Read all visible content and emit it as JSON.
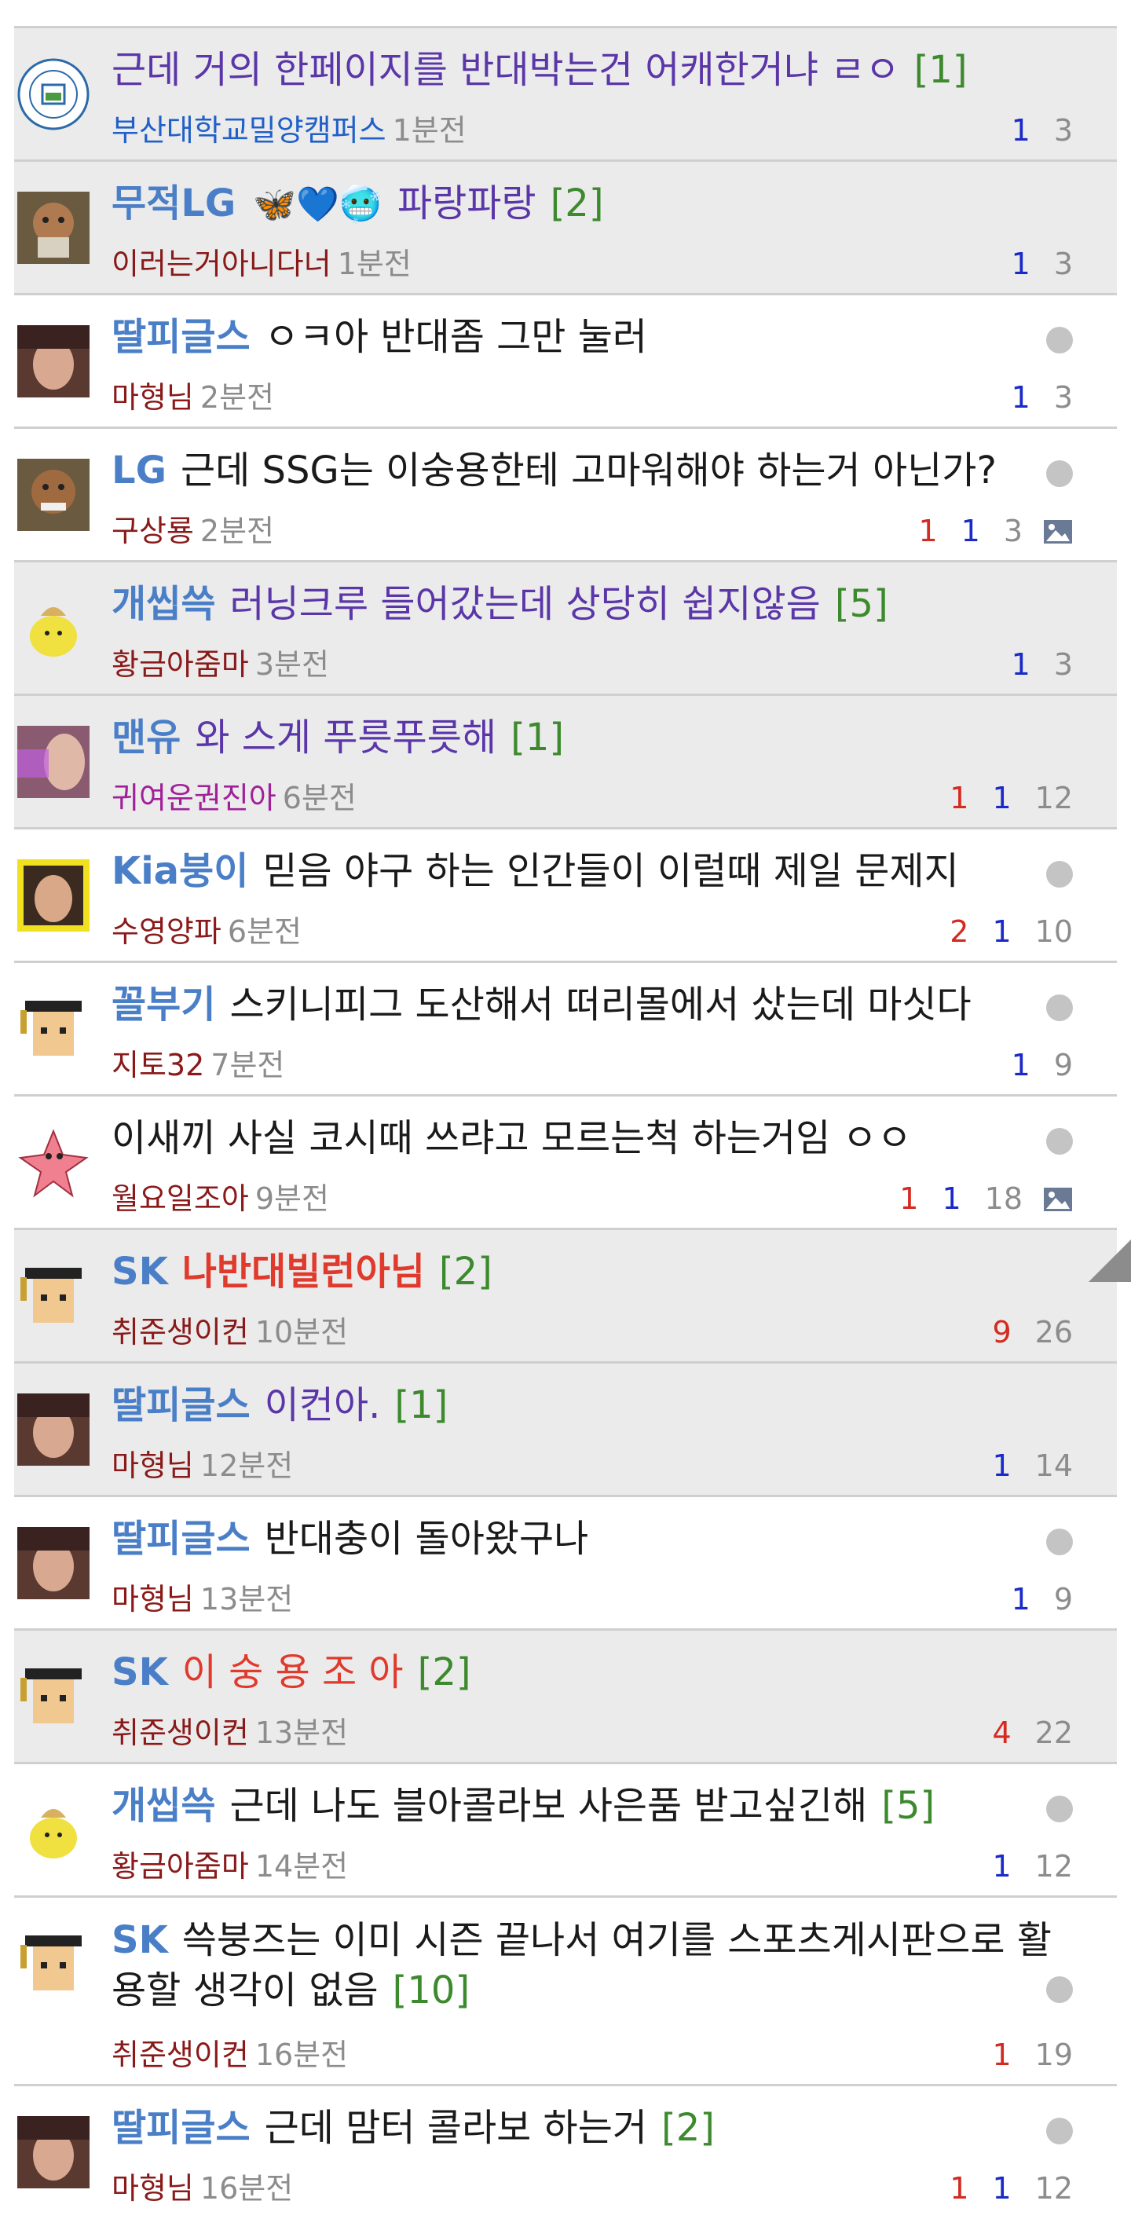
{
  "posts": [
    {
      "team": "",
      "title": "근데 거의 한페이지를 반대박는건 어캐한거냐 ㄹㅇ",
      "count": "[1]",
      "author": "부산대학교밀양캠퍼스",
      "time": "1분전",
      "stats": [
        "1",
        "3"
      ],
      "style": "purple"
    },
    {
      "team": "무적LG",
      "title": "파랑파랑",
      "count": "[2]",
      "author": "이러는거아니다너",
      "time": "1분전",
      "stats": [
        "1",
        "3"
      ],
      "style": "purple",
      "emoji": "🦋💙🥶"
    },
    {
      "team": "딸피글스",
      "title": "ㅇㅋ아 반대좀 그만 눌러",
      "count": "",
      "author": "마형님",
      "time": "2분전",
      "stats": [
        "1",
        "3"
      ],
      "style": "normal"
    },
    {
      "team": "LG",
      "title": "근데 SSG는 이숭용한테 고마워해야 하는거 아닌가?",
      "count": "",
      "author": "구상룡",
      "time": "2분전",
      "stats": [
        "1",
        "1",
        "3"
      ],
      "style": "normal"
    },
    {
      "team": "개씹쓱",
      "title": "러닝크루 들어갔는데 상당히 쉽지않음",
      "count": "[5]",
      "author": "황금아줌마",
      "time": "3분전",
      "stats": [
        "1",
        "3"
      ],
      "style": "purple"
    },
    {
      "team": "맨유",
      "title": "와 스게 푸릇푸릇해",
      "count": "[1]",
      "author": "귀여운권진아",
      "time": "6분전",
      "stats": [
        "1",
        "1",
        "12"
      ],
      "style": "purple"
    },
    {
      "team": "Kia붕이",
      "title": "믿음 야구 하는 인간들이 이럴때 제일 문제지",
      "count": "",
      "author": "수영양파",
      "time": "6분전",
      "stats": [
        "2",
        "1",
        "10"
      ],
      "style": "normal"
    },
    {
      "team": "꼴부기",
      "title": "스키니피그 도산해서 떠리몰에서 샀는데 마싯다",
      "count": "",
      "author": "지토32",
      "time": "7분전",
      "stats": [
        "1",
        "9"
      ],
      "style": "normal"
    },
    {
      "team": "",
      "title": "이새끼 사실 코시때 쓰랴고 모르는척 하는거임 ㅇㅇ",
      "count": "",
      "author": "월요일조아",
      "time": "9분전",
      "stats": [
        "1",
        "1",
        "18"
      ],
      "style": "normal"
    },
    {
      "team": "SK",
      "title": "나반대빌런아님",
      "count": "[2]",
      "author": "취준생이컨",
      "time": "10분전",
      "stats": [
        "9",
        "26"
      ],
      "style": "red"
    },
    {
      "team": "딸피글스",
      "title": "이컨아.",
      "count": "[1]",
      "author": "마형님",
      "time": "12분전",
      "stats": [
        "1",
        "14"
      ],
      "style": "purple"
    },
    {
      "team": "딸피글스",
      "title": "반대충이 돌아왔구나",
      "count": "",
      "author": "마형님",
      "time": "13분전",
      "stats": [
        "1",
        "9"
      ],
      "style": "normal"
    },
    {
      "team": "SK",
      "title": "이 숭 용 조 아",
      "count": "[2]",
      "author": "취준생이컨",
      "time": "13분전",
      "stats": [
        "4",
        "22"
      ],
      "style": "red"
    },
    {
      "team": "개씹쓱",
      "title": "근데 나도 블아콜라보 사은품 받고싶긴해",
      "count": "[5]",
      "author": "황금아줌마",
      "time": "14분전",
      "stats": [
        "1",
        "12"
      ],
      "style": "normal"
    },
    {
      "team": "SK",
      "title": "쓱붕즈는 이미 시즌 끝나서 여기를 스포츠게시판으로 활용할 생각이 없음",
      "count": "[10]",
      "author": "취준생이컨",
      "time": "16분전",
      "stats": [
        "1",
        "19"
      ],
      "style": "normal"
    },
    {
      "team": "딸피글스",
      "title": "근데 맘터 콜라보 하는거",
      "count": "[2]",
      "author": "마형님",
      "time": "16분전",
      "stats": [
        "1",
        "1",
        "12"
      ],
      "style": "normal"
    }
  ]
}
